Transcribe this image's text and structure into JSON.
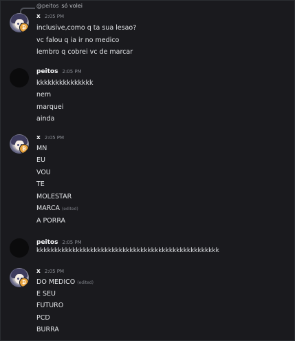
{
  "reply": {
    "name": "@peitos",
    "text": "só volei"
  },
  "messages": [
    {
      "author": "x",
      "time": "2:05 PM",
      "lines": [
        "inclusive,como q ta sua lesao?",
        "vc falou q ia ir no medico",
        "lembro q cobrei vc de marcar"
      ]
    },
    {
      "author": "peitos",
      "time": "2:05 PM",
      "lines": [
        "kkkkkkkkkkkkkkk",
        "nem",
        "marquei",
        "ainda"
      ]
    },
    {
      "author": "x",
      "time": "2:05 PM",
      "lines": [
        "MN",
        "EU",
        "VOU",
        "TE",
        "MOLESTAR",
        "MARCA",
        "A PORRA"
      ],
      "edited_label": "(edited)"
    },
    {
      "author": "peitos",
      "time": "2:05 PM",
      "lines": [
        "kkkkkkkkkkkkkkkkkkkkkkkkkkkkkkkkkkkkkkkkkkkkkkkkkkk"
      ]
    },
    {
      "author": "x",
      "time": "2:05 PM",
      "lines": [
        "DO MEDICO",
        "E SEU",
        "FUTURO",
        "PCD",
        "BURRA"
      ],
      "edited_label": "(edited)"
    }
  ],
  "colors": {
    "background": "#1a1a1e",
    "badge": "#e8a33c"
  }
}
